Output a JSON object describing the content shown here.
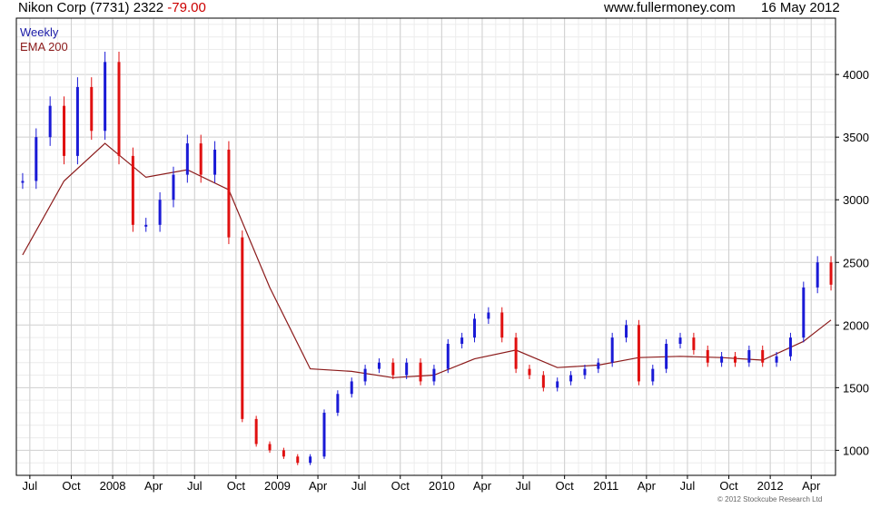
{
  "header": {
    "title": "Nikon Corp (7731) 2322",
    "change": "-79.00",
    "website": "www.fullermoney.com",
    "date": "16 May 2012"
  },
  "legend": {
    "weekly": "Weekly",
    "ema": "EMA 200"
  },
  "copyright": "© 2012 Stockcube Research Ltd",
  "colors": {
    "up": "#1a1ad6",
    "down": "#e01010",
    "ema": "#8b1a1a",
    "grid": "#d9d9d9"
  },
  "chart_data": {
    "type": "line",
    "title": "Nikon Corp (7731) 2322 -79.00",
    "x_tick_labels": [
      "Jul",
      "Oct",
      "2008",
      "Apr",
      "Jul",
      "Oct",
      "2009",
      "Apr",
      "Jul",
      "Oct",
      "2010",
      "Apr",
      "Jul",
      "Oct",
      "2011",
      "Apr",
      "Jul",
      "Oct",
      "2012",
      "Apr"
    ],
    "y_tick_labels": [
      1000,
      1500,
      2000,
      2500,
      3000,
      3500,
      4000
    ],
    "ylim": [
      800,
      4450
    ],
    "grid": true,
    "legend_position": "top-left",
    "x_start": "2007-06-01",
    "x_end": "2012-05-25",
    "series": [
      {
        "name": "Weekly",
        "style": "candlestick",
        "x": [
          "2007-06",
          "2007-07",
          "2007-08",
          "2007-09",
          "2007-10",
          "2007-11",
          "2007-12",
          "2008-01",
          "2008-02",
          "2008-03",
          "2008-04",
          "2008-05",
          "2008-06",
          "2008-07",
          "2008-08",
          "2008-09",
          "2008-10",
          "2008-11",
          "2008-12",
          "2009-01",
          "2009-02",
          "2009-03",
          "2009-04",
          "2009-05",
          "2009-06",
          "2009-07",
          "2009-08",
          "2009-09",
          "2009-10",
          "2009-11",
          "2009-12",
          "2010-01",
          "2010-02",
          "2010-03",
          "2010-04",
          "2010-05",
          "2010-06",
          "2010-07",
          "2010-08",
          "2010-09",
          "2010-10",
          "2010-11",
          "2010-12",
          "2011-01",
          "2011-02",
          "2011-03",
          "2011-04",
          "2011-05",
          "2011-06",
          "2011-07",
          "2011-08",
          "2011-09",
          "2011-10",
          "2011-11",
          "2011-12",
          "2012-01",
          "2012-02",
          "2012-03",
          "2012-04",
          "2012-05"
        ],
        "y": [
          3150,
          3500,
          3750,
          3350,
          3900,
          3550,
          4100,
          3350,
          2800,
          2800,
          3000,
          3200,
          3450,
          3200,
          3400,
          2700,
          1250,
          1050,
          1000,
          950,
          900,
          950,
          1300,
          1450,
          1550,
          1650,
          1700,
          1600,
          1700,
          1550,
          1650,
          1850,
          1900,
          2050,
          2100,
          1900,
          1650,
          1600,
          1500,
          1550,
          1600,
          1650,
          1700,
          1900,
          2000,
          1550,
          1650,
          1850,
          1900,
          1800,
          1700,
          1750,
          1700,
          1800,
          1700,
          1750,
          1900,
          2300,
          2500,
          2322
        ]
      },
      {
        "name": "EMA 200",
        "x": [
          "2007-06",
          "2007-09",
          "2007-12",
          "2008-03",
          "2008-06",
          "2008-09",
          "2008-12",
          "2009-03",
          "2009-06",
          "2009-09",
          "2009-12",
          "2010-03",
          "2010-06",
          "2010-09",
          "2010-12",
          "2011-03",
          "2011-06",
          "2011-09",
          "2011-12",
          "2012-03",
          "2012-05"
        ],
        "y": [
          2560,
          3150,
          3450,
          3180,
          3240,
          3080,
          2300,
          1650,
          1630,
          1580,
          1600,
          1730,
          1800,
          1660,
          1680,
          1740,
          1750,
          1740,
          1720,
          1870,
          2040
        ]
      }
    ]
  }
}
